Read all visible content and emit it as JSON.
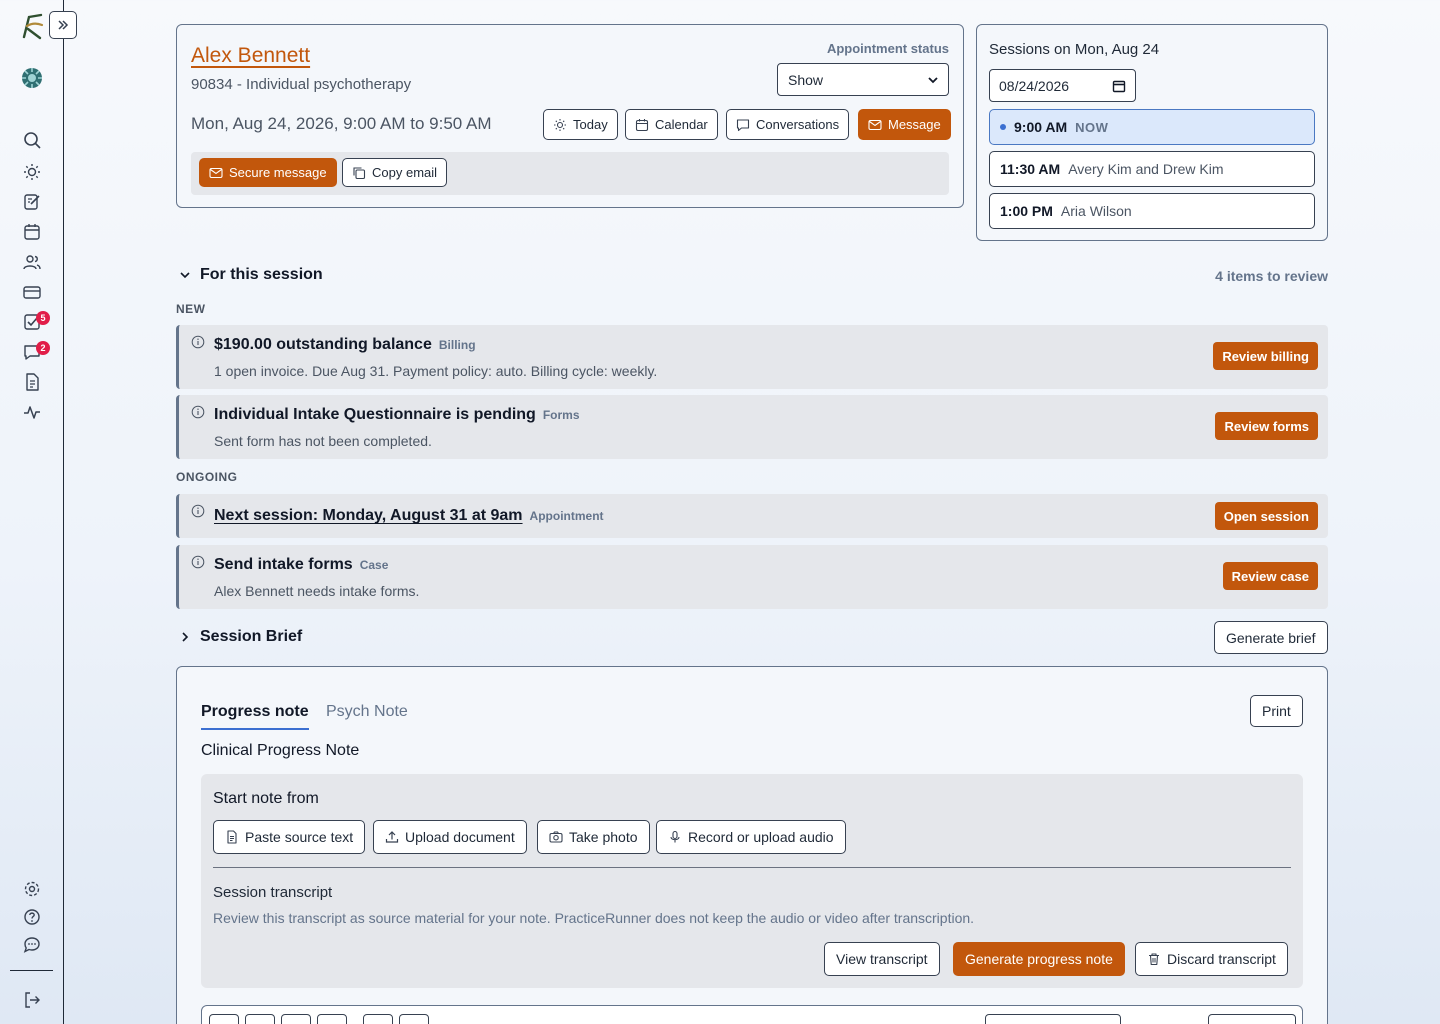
{
  "app": {
    "colors": {
      "accent": "#c2570c",
      "link_blue": "#3b6fd1",
      "badge": "#e11d48"
    }
  },
  "sidebar": {
    "icons": [
      "search-icon",
      "sun-icon",
      "note-edit-icon",
      "calendar-icon",
      "users-icon",
      "credit-card-icon",
      "task-check-icon",
      "chat-icon",
      "document-icon",
      "activity-icon"
    ],
    "tasks_badge": "5",
    "messages_badge": "2",
    "bottom_icons": [
      "settings-icon",
      "help-icon",
      "feedback-icon",
      "logout-icon"
    ]
  },
  "client": {
    "name": "Alex Bennett",
    "service": "90834 - Individual psychotherapy",
    "datetime": "Mon, Aug 24, 2026, 9:00 AM to 9:50 AM",
    "status_label": "Appointment status",
    "status_value": "Show",
    "buttons": {
      "today": "Today",
      "calendar": "Calendar",
      "conversations": "Conversations",
      "message": "Message"
    },
    "contact": {
      "secure_message": "Secure message",
      "copy_email": "Copy email"
    }
  },
  "sessions": {
    "title": "Sessions on Mon, Aug 24",
    "date_value": "08/24/2026",
    "slots": [
      {
        "time": "9:00 AM",
        "who": "",
        "now": "NOW"
      },
      {
        "time": "11:30 AM",
        "who": "Avery Kim and Drew Kim"
      },
      {
        "time": "1:00 PM",
        "who": "Aria Wilson"
      }
    ]
  },
  "review": {
    "heading": "For this session",
    "count": "4 items to review",
    "new_label": "NEW",
    "ongoing_label": "ONGOING",
    "items": [
      {
        "title": "$190.00 outstanding balance",
        "tag": "Billing",
        "desc": "1 open invoice. Due Aug 31. Payment policy: auto. Billing cycle: weekly.",
        "action": "Review billing"
      },
      {
        "title": "Individual Intake Questionnaire is pending",
        "tag": "Forms",
        "desc": "Sent form has not been completed.",
        "action": "Review forms"
      },
      {
        "title": "Next session: Monday, August 31 at 9am",
        "tag": "Appointment",
        "desc": "",
        "action": "Open session"
      },
      {
        "title": "Send intake forms",
        "tag": "Case",
        "desc": "Alex Bennett needs intake forms.",
        "action": "Review case"
      }
    ]
  },
  "brief": {
    "heading": "Session Brief",
    "action": "Generate brief"
  },
  "note": {
    "tabs": [
      "Progress note",
      "Psych Note"
    ],
    "print": "Print",
    "heading": "Clinical Progress Note",
    "start_title": "Start note from",
    "sources": [
      "Paste source text",
      "Upload document",
      "Take photo",
      "Record or upload audio"
    ],
    "transcript_title": "Session transcript",
    "transcript_desc": "Review this transcript as source material for your note. PracticeRunner does not keep the audio or video after transcription.",
    "transcript_actions": {
      "view": "View transcript",
      "generate": "Generate progress note",
      "discard": "Discard transcript"
    }
  }
}
